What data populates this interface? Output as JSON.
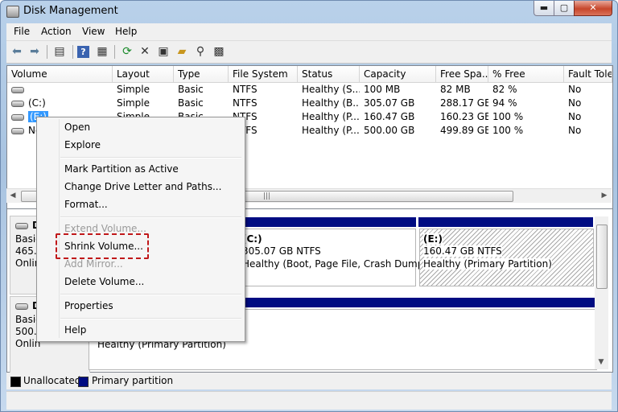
{
  "window": {
    "title": "Disk Management",
    "min": "▬",
    "max": "▢",
    "close": "✕"
  },
  "menubar": [
    "File",
    "Action",
    "View",
    "Help"
  ],
  "toolbar_icons": [
    "back-icon",
    "forward-icon",
    "console-icon",
    "help-icon",
    "properties-icon",
    "refresh-icon",
    "delete-icon",
    "settings-icon",
    "open-icon",
    "search-icon",
    "magic-icon"
  ],
  "list": {
    "columns": [
      "Volume",
      "Layout",
      "Type",
      "File System",
      "Status",
      "Capacity",
      "Free Spa...",
      "% Free",
      "Fault Tolera"
    ],
    "rows": [
      {
        "volume": "",
        "layout": "Simple",
        "type": "Basic",
        "fs": "NTFS",
        "status": "Healthy (S...",
        "capacity": "100 MB",
        "free": "82 MB",
        "pct": "82 %",
        "fault": "No"
      },
      {
        "volume": "(C:)",
        "layout": "Simple",
        "type": "Basic",
        "fs": "NTFS",
        "status": "Healthy (B...",
        "capacity": "305.07 GB",
        "free": "288.17 GB",
        "pct": "94 %",
        "fault": "No"
      },
      {
        "volume": "(E:)",
        "layout": "Simple",
        "type": "Basic",
        "fs": "NTFS",
        "status": "Healthy (P...",
        "capacity": "160.47 GB",
        "free": "160.23 GB",
        "pct": "100 %",
        "fault": "No"
      },
      {
        "volume": "New",
        "layout": "",
        "type": "",
        "fs": "NTFS",
        "status": "Healthy (P...",
        "capacity": "500.00 GB",
        "free": "499.89 GB",
        "pct": "100 %",
        "fault": "No"
      }
    ]
  },
  "disks": [
    {
      "name": "Di",
      "type": "Basic",
      "size": "465.7",
      "status": "Onlin"
    },
    {
      "name": "Di",
      "type": "Basic",
      "size": "500.0",
      "status": "Onlin"
    }
  ],
  "partitions": {
    "c_label": "(C:)",
    "c_size": "305.07 GB NTFS",
    "c_status": "Healthy (Boot, Page File, Crash Dump, Pr",
    "e_label": "(E:)",
    "e_size": "160.47 GB NTFS",
    "e_status": "Healthy (Primary Partition)",
    "new_status": "Healthy (Primary Partition)"
  },
  "legend": {
    "unallocated": "Unallocated",
    "primary": "Primary partition",
    "unallocated_color": "#000000",
    "primary_color": "#000c82"
  },
  "context_menu": {
    "open": "Open",
    "explore": "Explore",
    "mark_active": "Mark Partition as Active",
    "change_letter": "Change Drive Letter and Paths...",
    "format": "Format...",
    "extend": "Extend Volume...",
    "shrink": "Shrink Volume...",
    "add_mirror": "Add Mirror...",
    "delete": "Delete Volume...",
    "properties": "Properties",
    "help": "Help"
  },
  "colors": {
    "partition_header": "#000c82",
    "selection": "#3399ff",
    "highlight": "#c0181a"
  }
}
